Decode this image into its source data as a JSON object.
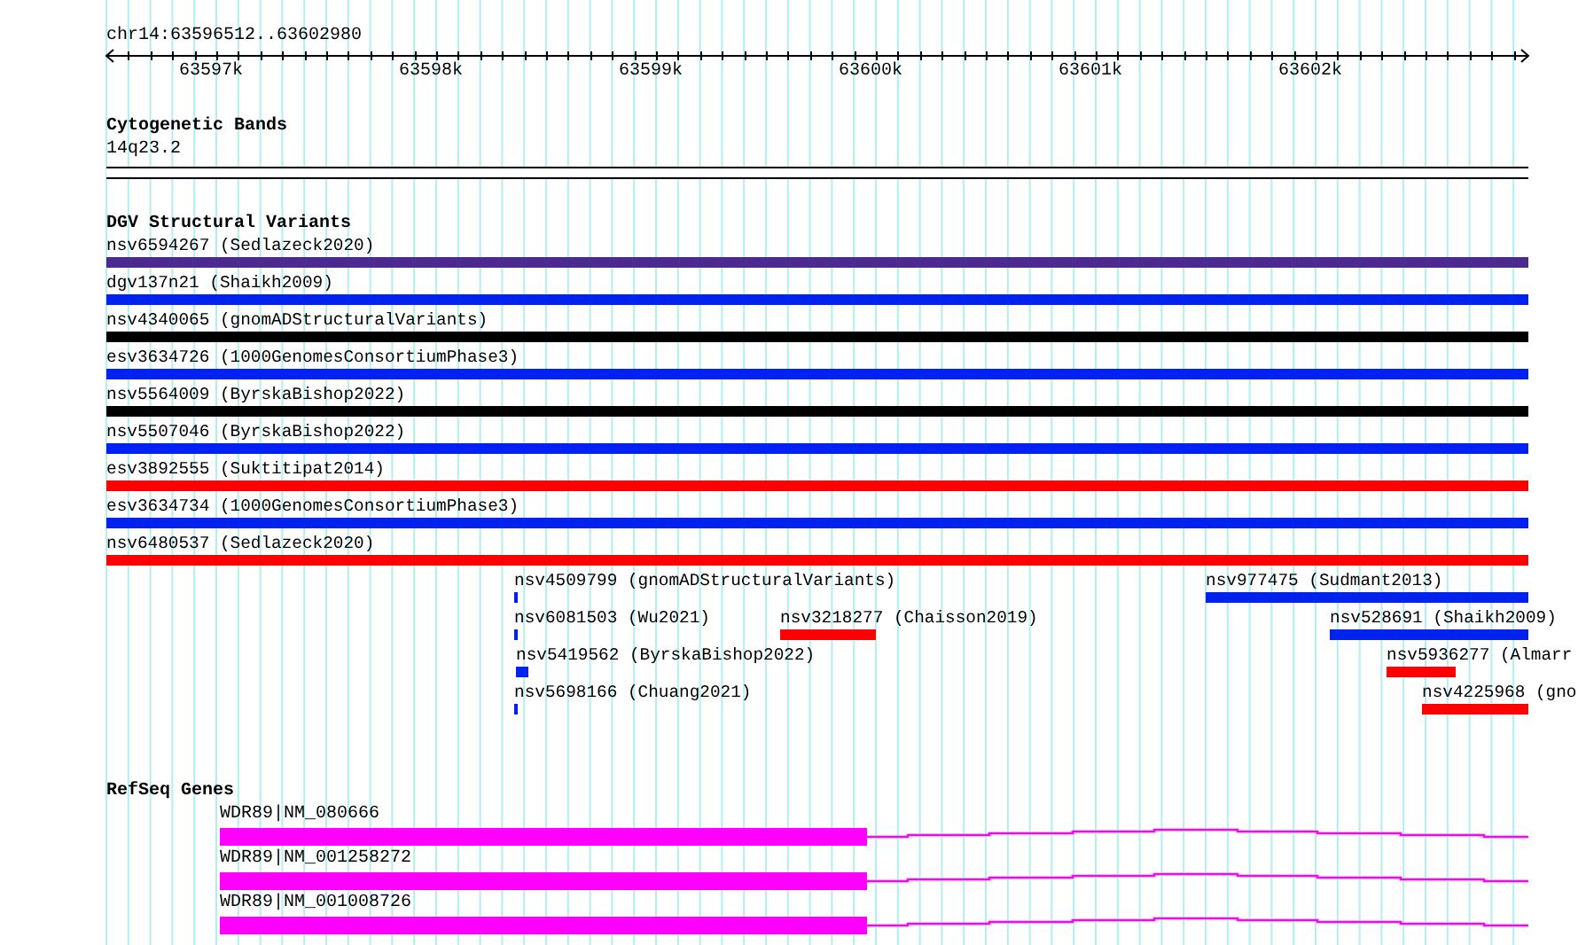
{
  "ruler": {
    "location": "chr14:63596512..63602980",
    "ticks": [
      "63597k",
      "63598k",
      "63599k",
      "63600k",
      "63601k",
      "63602k"
    ]
  },
  "cytogenetic_bands": {
    "title": "Cytogenetic Bands",
    "band": "14q23.2"
  },
  "dgv_structural_variants": {
    "title": "DGV Structural Variants",
    "features": [
      {
        "label": "nsv6594267 (Sedlazeck2020)",
        "color": "#4b2b8f"
      },
      {
        "label": "dgv137n21 (Shaikh2009)",
        "color": "#0022ee"
      },
      {
        "label": "nsv4340065 (gnomADStructuralVariants)",
        "color": "#000000"
      },
      {
        "label": "esv3634726 (1000GenomesConsortiumPhase3)",
        "color": "#0022ee"
      },
      {
        "label": "nsv5564009 (ByrskaBishop2022)",
        "color": "#000000"
      },
      {
        "label": "nsv5507046 (ByrskaBishop2022)",
        "color": "#0022ee"
      },
      {
        "label": "esv3892555 (Suktitipat2014)",
        "color": "#ff0000"
      },
      {
        "label": "esv3634734 (1000GenomesConsortiumPhase3)",
        "color": "#0022ee"
      },
      {
        "label": "nsv6480537 (Sedlazeck2020)",
        "color": "#ff0000"
      },
      {
        "label": "nsv4509799 (gnomADStructuralVariants)",
        "color": "#0022ee"
      },
      {
        "label": "nsv977475 (Sudmant2013)",
        "color": "#0022ee"
      },
      {
        "label": "nsv6081503 (Wu2021)",
        "color": "#0022ee"
      },
      {
        "label": "nsv3218277 (Chaisson2019)",
        "color": "#ff0000"
      },
      {
        "label": "nsv528691 (Shaikh2009)",
        "color": "#0022ee"
      },
      {
        "label": "nsv5419562 (ByrskaBishop2022)",
        "color": "#0022ee"
      },
      {
        "label": "nsv5936277 (Almarr",
        "color": "#ff0000"
      },
      {
        "label": "nsv5698166 (Chuang2021)",
        "color": "#0022ee"
      },
      {
        "label": "nsv4225968 (gno",
        "color": "#ff0000"
      }
    ]
  },
  "refseq_genes": {
    "title": "RefSeq Genes",
    "genes": [
      {
        "label": "WDR89|NM_080666"
      },
      {
        "label": "WDR89|NM_001258272"
      },
      {
        "label": "WDR89|NM_001008726"
      }
    ]
  }
}
